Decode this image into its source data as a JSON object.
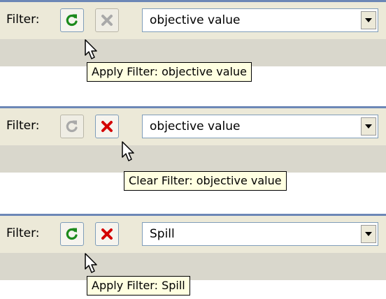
{
  "panels": [
    {
      "filter_label": "Filter:",
      "apply_enabled": true,
      "clear_enabled": false,
      "dropdown_value": "objective value",
      "tooltip": "Apply Filter: objective value"
    },
    {
      "filter_label": "Filter:",
      "apply_enabled": false,
      "clear_enabled": true,
      "dropdown_value": "objective value",
      "tooltip": "Clear Filter: objective value"
    },
    {
      "filter_label": "Filter:",
      "apply_enabled": true,
      "clear_enabled": true,
      "dropdown_value": "Spill",
      "tooltip": "Apply Filter: Spill"
    }
  ],
  "icons": {
    "apply": "refresh-icon",
    "clear": "close-x-icon",
    "dropdown": "dropdown-arrow-icon",
    "pointer": "mouse-cursor-icon"
  },
  "colors": {
    "apply_enabled": "#1c8a1c",
    "clear_enabled": "#d40000",
    "disabled": "#a9a9a9",
    "toolbar": "#ece9d8",
    "tooltip_bg": "#ffffe1"
  }
}
